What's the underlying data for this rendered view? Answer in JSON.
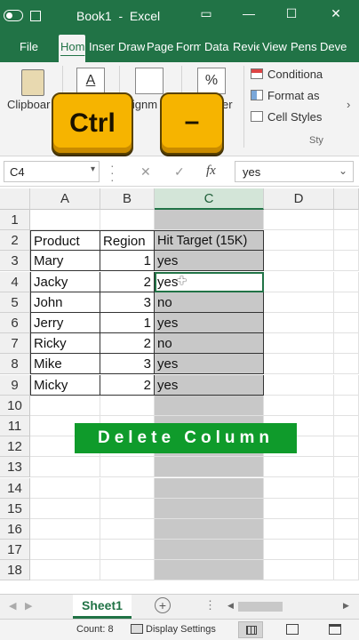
{
  "title_bar": {
    "autosave_icon": "toggle-icon",
    "title": "Book1  -  Excel",
    "controls": [
      "▭",
      "—",
      "☐",
      "✕"
    ]
  },
  "tabs": [
    {
      "label": "File",
      "active": false
    },
    {
      "label": "Hom",
      "active": true
    },
    {
      "label": "Inser",
      "active": false
    },
    {
      "label": "Draw",
      "active": false
    },
    {
      "label": "Page",
      "active": false
    },
    {
      "label": "Form",
      "active": false
    },
    {
      "label": "Data",
      "active": false
    },
    {
      "label": "Revie",
      "active": false
    },
    {
      "label": "View",
      "active": false
    },
    {
      "label": "Pens",
      "active": false
    },
    {
      "label": "Deve",
      "active": false
    }
  ],
  "ribbon": {
    "clipboard": "Clipboar",
    "alignment": "lignm",
    "number": "er",
    "percent_symbol": "%",
    "font_symbol": "A",
    "conditional": "Conditiona",
    "format_as": "Format as",
    "cell_styles": "Cell Styles",
    "styles_group": "Sty"
  },
  "keys": {
    "ctrl": "Ctrl",
    "minus": "–"
  },
  "formula_bar": {
    "name_box": "C4",
    "cancel": "✕",
    "enter": "✓",
    "fx": "fx",
    "value": "yes"
  },
  "grid": {
    "columns": [
      "A",
      "B",
      "C",
      "D"
    ],
    "rows": [
      "1",
      "2",
      "3",
      "4",
      "5",
      "6",
      "7",
      "8",
      "9",
      "10",
      "11",
      "12",
      "13",
      "14",
      "15",
      "16",
      "17",
      "18"
    ],
    "header": {
      "a": "Product",
      "b": "Region",
      "c": "Hit Target (15K)"
    },
    "data": [
      {
        "product": "Mary",
        "region": "1",
        "hit": "yes"
      },
      {
        "product": "Jacky",
        "region": "2",
        "hit": "yes"
      },
      {
        "product": "John",
        "region": "3",
        "hit": "no"
      },
      {
        "product": "Jerry",
        "region": "1",
        "hit": "yes"
      },
      {
        "product": "Ricky",
        "region": "2",
        "hit": "no"
      },
      {
        "product": "Mike",
        "region": "3",
        "hit": "yes"
      },
      {
        "product": "Micky",
        "region": "2",
        "hit": "yes"
      }
    ]
  },
  "banner": "Delete Column",
  "sheet_tabs": {
    "active": "Sheet1",
    "add": "+"
  },
  "status_bar": {
    "count": "Count: 8",
    "display_settings": "Display Settings"
  },
  "colors": {
    "excel_green": "#217346",
    "banner_green": "#0f9b2b",
    "key_yellow": "#f6b400"
  }
}
